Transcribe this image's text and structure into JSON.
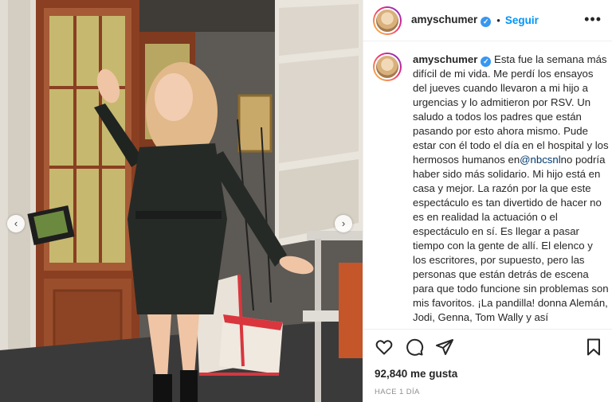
{
  "post": {
    "username": "amyschumer",
    "follow_label": "Seguir",
    "dot": "•",
    "more_label": "•••",
    "verified_mark": "✓",
    "caption_pre": "Esta fue la semana más difícil de mi vida. Me perdí los ensayos del jueves cuando llevaron a mi hijo a urgencias y lo admitieron por RSV. Un saludo a todos los padres que están pasando por esto ahora mismo. Pude estar con él todo el día en el hospital y los hermosos humanos en",
    "caption_mention": "@nbcsnl",
    "caption_post": "no podría haber sido más solidario. Mi hijo está en casa y mejor. La razón por la que este espectáculo es tan divertido de hacer no es en realidad la actuación o el espectáculo en sí. Es llegar a pasar tiempo con la gente de allí. El elenco y los escritores, por supuesto, pero las personas que están detrás de escena para que todo funcione sin problemas son mis favoritos. ¡La pandilla! donna Alemán, Jodi, Genna, Tom Wally y así",
    "likes": "92,840 me gusta",
    "time_ago": "HACE 1 DÍA"
  },
  "carousel": {
    "prev": "‹",
    "next": "›"
  },
  "icons": {
    "like": "heart-icon",
    "comment": "comment-icon",
    "share": "share-icon",
    "save": "bookmark-icon",
    "verified": "verified-badge-icon"
  },
  "colors": {
    "accent": "#0095f6",
    "text": "#262626",
    "muted": "#8e8e8e",
    "verified": "#3897f0"
  }
}
